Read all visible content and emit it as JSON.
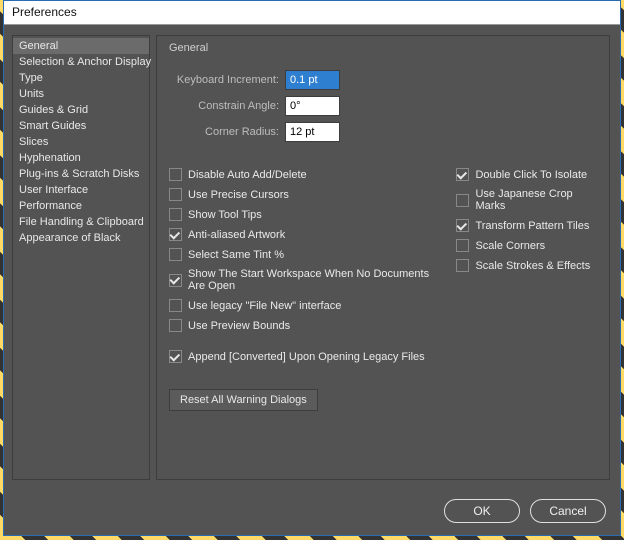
{
  "dialog": {
    "title": "Preferences"
  },
  "sidebar": {
    "items": [
      {
        "label": "General",
        "selected": true
      },
      {
        "label": "Selection & Anchor Display",
        "selected": false
      },
      {
        "label": "Type",
        "selected": false
      },
      {
        "label": "Units",
        "selected": false
      },
      {
        "label": "Guides & Grid",
        "selected": false
      },
      {
        "label": "Smart Guides",
        "selected": false
      },
      {
        "label": "Slices",
        "selected": false
      },
      {
        "label": "Hyphenation",
        "selected": false
      },
      {
        "label": "Plug-ins & Scratch Disks",
        "selected": false
      },
      {
        "label": "User Interface",
        "selected": false
      },
      {
        "label": "Performance",
        "selected": false
      },
      {
        "label": "File Handling & Clipboard",
        "selected": false
      },
      {
        "label": "Appearance of Black",
        "selected": false
      }
    ]
  },
  "panel": {
    "heading": "General",
    "fields": {
      "keyboard_increment": {
        "label": "Keyboard Increment:",
        "value": "0.1 pt",
        "selected": true
      },
      "constrain_angle": {
        "label": "Constrain Angle:",
        "value": "0°",
        "selected": false
      },
      "corner_radius": {
        "label": "Corner Radius:",
        "value": "12 pt",
        "selected": false
      }
    },
    "checks_left": [
      {
        "label": "Disable Auto Add/Delete",
        "checked": false
      },
      {
        "label": "Use Precise Cursors",
        "checked": false
      },
      {
        "label": "Show Tool Tips",
        "checked": false
      },
      {
        "label": "Anti-aliased Artwork",
        "checked": true
      },
      {
        "label": "Select Same Tint %",
        "checked": false
      },
      {
        "label": "Show The Start Workspace When No Documents Are Open",
        "checked": true
      },
      {
        "label": "Use legacy \"File New\" interface",
        "checked": false
      },
      {
        "label": "Use Preview Bounds",
        "checked": false
      }
    ],
    "checks_right": [
      {
        "label": "Double Click To Isolate",
        "checked": true
      },
      {
        "label": "Use Japanese Crop Marks",
        "checked": false
      },
      {
        "label": "Transform Pattern Tiles",
        "checked": true
      },
      {
        "label": "Scale Corners",
        "checked": false
      },
      {
        "label": "Scale Strokes & Effects",
        "checked": false
      }
    ],
    "append_converted": {
      "label": "Append [Converted] Upon Opening Legacy Files",
      "checked": true
    },
    "reset_button": "Reset All Warning Dialogs"
  },
  "footer": {
    "ok": "OK",
    "cancel": "Cancel"
  }
}
